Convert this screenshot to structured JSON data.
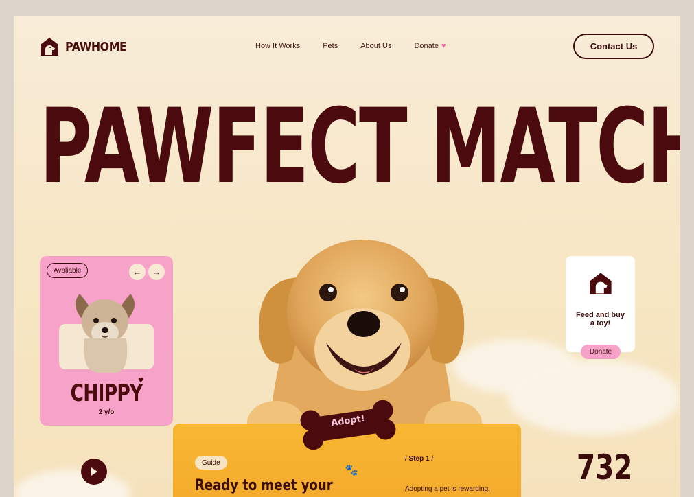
{
  "brand": {
    "name": "PAWHOME",
    "logo_icon": "house-dog-icon"
  },
  "nav": {
    "items": [
      {
        "label": "How It Works"
      },
      {
        "label": "Pets"
      },
      {
        "label": "About Us"
      },
      {
        "label": "Donate",
        "icon": "heart-icon"
      }
    ],
    "contact_label": "Contact Us"
  },
  "hero": {
    "title": "PAWFECT MATCH"
  },
  "pet_card": {
    "status": "Avaliable",
    "name": "CHIPPY",
    "age": "2 y/o",
    "prev_icon": "arrow-left-icon",
    "next_icon": "arrow-right-icon"
  },
  "adopt": {
    "label": "Adopt!"
  },
  "donate_card": {
    "text_line1": "Feed and buy",
    "text_line2": "a toy!",
    "button_label": "Donate"
  },
  "guide": {
    "tag": "Guide",
    "title": "Ready to meet your",
    "step_label": "/ Step 1 /",
    "step_text": "Adopting a pet is rewarding,"
  },
  "stats": {
    "number": "732"
  },
  "colors": {
    "maroon": "#4b0a0d",
    "pink": "#f7a2c9",
    "yellow": "#f5ab2c",
    "cream": "#f8ecd8"
  }
}
